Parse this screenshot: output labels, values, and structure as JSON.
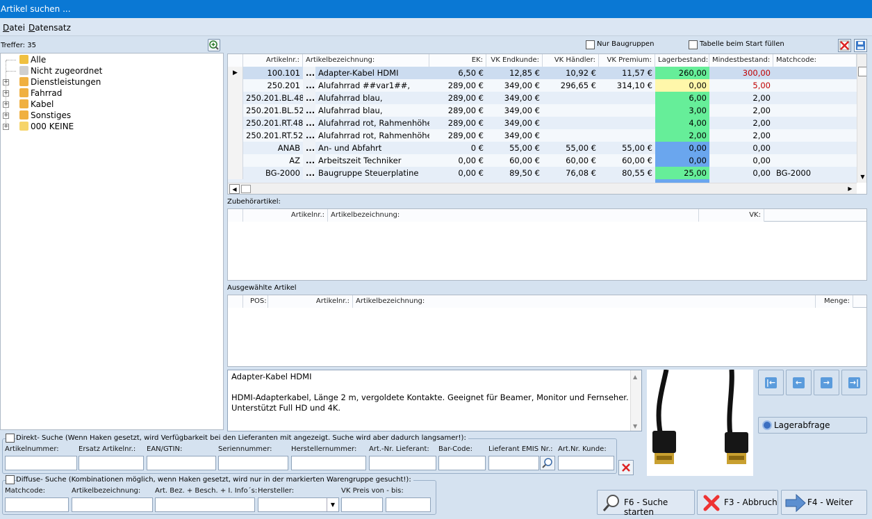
{
  "window": {
    "title": "Artikel suchen ..."
  },
  "menu": {
    "items": [
      "Datei",
      "Datensatz"
    ]
  },
  "tree": {
    "hits": "Treffer: 35",
    "nodes": [
      {
        "label": "Alle",
        "expandable": false
      },
      {
        "label": "Nicht zugeordnet",
        "expandable": false
      },
      {
        "label": "Dienstleistungen",
        "expandable": true
      },
      {
        "label": "Fahrrad",
        "expandable": true
      },
      {
        "label": "Kabel",
        "expandable": true
      },
      {
        "label": "Sonstiges",
        "expandable": true
      },
      {
        "label": "000 KEINE",
        "expandable": true
      }
    ]
  },
  "options": {
    "only_groups": "Nur Baugruppen",
    "fill_on_start": "Tabelle beim Start füllen"
  },
  "main_table": {
    "columns": [
      "Artikelnr.:",
      "Artikelbezeichnung:",
      "EK:",
      "VK Endkunde:",
      "VK Händler:",
      "VK Premium:",
      "Lagerbestand:",
      "Mindestbestand:",
      "Matchcode:"
    ],
    "rows": [
      {
        "nr": "100.101",
        "name": "Adapter-Kabel HDMI",
        "ek": "6,50 €",
        "vk_end": "12,85 €",
        "vk_h": "10,92 €",
        "vk_p": "11,57 €",
        "lager": "260,00",
        "min": "300,00",
        "match": "",
        "lager_color": "#66ee99",
        "min_color": "#c00000",
        "selected": true
      },
      {
        "nr": "250.201",
        "name": "Alufahrrad ##var1##,",
        "ek": "289,00 €",
        "vk_end": "349,00 €",
        "vk_h": "296,65 €",
        "vk_p": "314,10 €",
        "lager": "0,00",
        "min": "5,00",
        "match": "",
        "lager_color": "#fff7aa",
        "min_color": "#c00000",
        "selected": false
      },
      {
        "nr": "250.201.BL.48",
        "name": "Alufahrrad blau,",
        "ek": "289,00 €",
        "vk_end": "349,00 €",
        "vk_h": "",
        "vk_p": "",
        "lager": "6,00",
        "min": "2,00",
        "match": "",
        "lager_color": "#66ee99",
        "min_color": "#000000",
        "selected": false
      },
      {
        "nr": "250.201.BL.52",
        "name": "Alufahrrad blau,",
        "ek": "289,00 €",
        "vk_end": "349,00 €",
        "vk_h": "",
        "vk_p": "",
        "lager": "3,00",
        "min": "2,00",
        "match": "",
        "lager_color": "#66ee99",
        "min_color": "#000000",
        "selected": false
      },
      {
        "nr": "250.201.RT.48",
        "name": "Alufahrrad rot, Rahmenhöhe",
        "ek": "289,00 €",
        "vk_end": "349,00 €",
        "vk_h": "",
        "vk_p": "",
        "lager": "4,00",
        "min": "2,00",
        "match": "",
        "lager_color": "#66ee99",
        "min_color": "#000000",
        "selected": false
      },
      {
        "nr": "250.201.RT.52",
        "name": "Alufahrrad rot, Rahmenhöhe",
        "ek": "289,00 €",
        "vk_end": "349,00 €",
        "vk_h": "",
        "vk_p": "",
        "lager": "2,00",
        "min": "2,00",
        "match": "",
        "lager_color": "#66ee99",
        "min_color": "#000000",
        "selected": false
      },
      {
        "nr": "ANAB",
        "name": "An- und Abfahrt",
        "ek": "0 €",
        "vk_end": "55,00 €",
        "vk_h": "55,00 €",
        "vk_p": "55,00 €",
        "lager": "0,00",
        "min": "0,00",
        "match": "",
        "lager_color": "#6aa6ee",
        "min_color": "#000000",
        "selected": false
      },
      {
        "nr": "AZ",
        "name": "Arbeitszeit Techniker",
        "ek": "0,00 €",
        "vk_end": "60,00 €",
        "vk_h": "60,00 €",
        "vk_p": "60,00 €",
        "lager": "0,00",
        "min": "0,00",
        "match": "",
        "lager_color": "#6aa6ee",
        "min_color": "#000000",
        "selected": false
      },
      {
        "nr": "BG-2000",
        "name": "Baugruppe Steuerplatine",
        "ek": "0,00 €",
        "vk_end": "89,50 €",
        "vk_h": "76,08 €",
        "vk_p": "80,55 €",
        "lager": "25,00",
        "min": "0,00",
        "match": "BG-2000",
        "lager_color": "#66ee99",
        "min_color": "#000000",
        "selected": false
      }
    ]
  },
  "accessory": {
    "section": "Zubehörartikel:",
    "columns": [
      "Artikelnr.:",
      "Artikelbezeichnung:",
      "VK:"
    ]
  },
  "selected_items": {
    "section": "Ausgewählte Artikel",
    "columns": [
      "POS:",
      "Artikelnr.:",
      "Artikelbezeichnung:",
      "Menge:"
    ]
  },
  "description": {
    "title": "Adapter-Kabel HDMI",
    "line1": "HDMI-Adapterkabel, Länge 2 m, vergoldete Kontakte. Geeignet für Beamer, Monitor und Fernseher.",
    "line2": "Unterstützt Full HD und 4K."
  },
  "stock_query": {
    "label": "Lagerabfrage"
  },
  "direct_search": {
    "title": "Direkt- Suche (Wenn Haken gesetzt, wird Verfügbarkeit bei den Lieferanten mit angezeigt. Suche wird aber dadurch langsamer!):",
    "fields": [
      "Artikelnummer:",
      "Ersatz Artikelnr.:",
      "EAN/GTIN:",
      "Seriennummer:",
      "Herstellernummer:",
      "Art.-Nr. Lieferant:",
      "Bar-Code:",
      "Lieferant EMIS Nr.:",
      "Art.Nr. Kunde:"
    ]
  },
  "diffuse_search": {
    "title": "Diffuse- Suche (Kombinationen möglich, wenn Haken gesetzt, wird nur in der markierten Warengruppe gesucht!):",
    "fields": [
      "Matchcode:",
      "Artikelbezeichnung:",
      "Art. Bez. + Besch. + I. Info´s:",
      "Hersteller:",
      "VK Preis von - bis:"
    ]
  },
  "buttons": {
    "search": "F6 - Suche starten",
    "abort": "F3 - Abbruch",
    "next": "F4 - Weiter"
  }
}
